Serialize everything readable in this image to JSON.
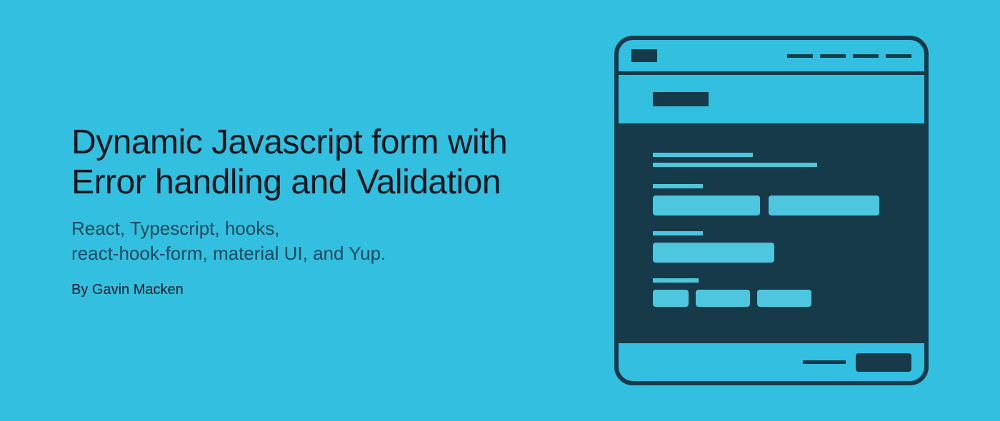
{
  "headline": {
    "title": "Dynamic Javascript form with Error handling and Validation",
    "subtitle": "React, Typescript, hooks,\nreact-hook-form, material UI, and Yup.",
    "byline": "By Gavin Macken"
  },
  "colors": {
    "background": "#32BFE0",
    "darkTeal": "#163A4A",
    "lightTeal": "#4FC6E0"
  }
}
